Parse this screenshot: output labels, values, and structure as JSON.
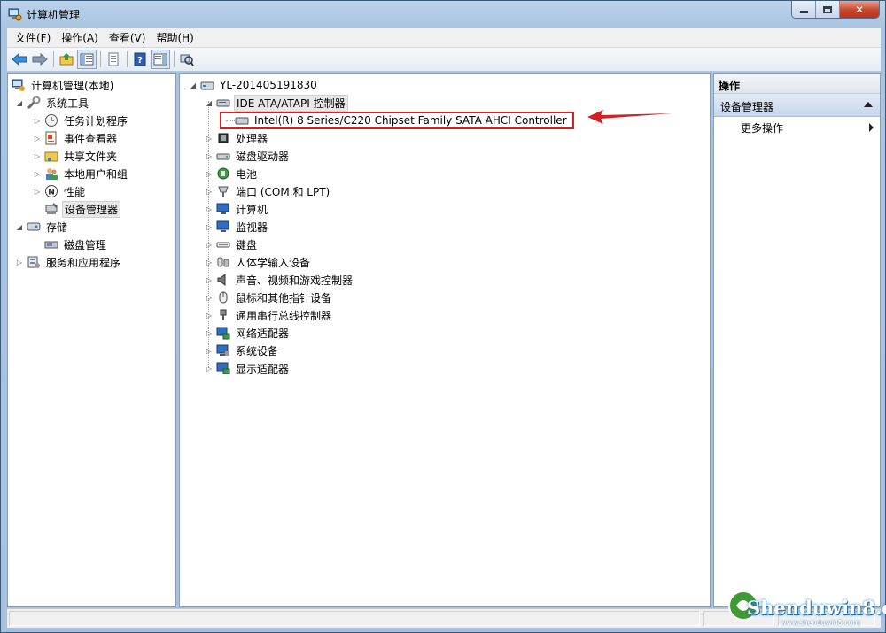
{
  "window": {
    "title": "计算机管理"
  },
  "menu": [
    "文件(F)",
    "操作(A)",
    "查看(V)",
    "帮助(H)"
  ],
  "toolbar": {
    "buttons": [
      "back-icon",
      "forward-icon",
      "up-folder-icon",
      "show-hide-tree-icon",
      "properties-icon",
      "help-icon",
      "show-action-pane-icon",
      "scan-hardware-icon"
    ]
  },
  "left_tree": {
    "root": "计算机管理(本地)",
    "system_tools": "系统工具",
    "task_scheduler": "任务计划程序",
    "event_viewer": "事件查看器",
    "shared_folders": "共享文件夹",
    "local_users": "本地用户和组",
    "performance": "性能",
    "device_manager": "设备管理器",
    "storage": "存储",
    "disk_management": "磁盘管理",
    "services_apps": "服务和应用程序"
  },
  "device_tree": {
    "computer_name": "YL-201405191830",
    "ide_controller": "IDE ATA/ATAPI 控制器",
    "ide_child": "Intel(R) 8 Series/C220 Chipset Family SATA AHCI Controller",
    "categories": [
      "处理器",
      "磁盘驱动器",
      "电池",
      "端口 (COM 和 LPT)",
      "计算机",
      "监视器",
      "键盘",
      "人体学输入设备",
      "声音、视频和游戏控制器",
      "鼠标和其他指针设备",
      "通用串行总线控制器",
      "网络适配器",
      "系统设备",
      "显示适配器"
    ]
  },
  "actions_pane": {
    "header": "操作",
    "group": "设备管理器",
    "more_actions": "更多操作"
  },
  "annotation": {
    "color": "#d61f1f"
  },
  "watermark": {
    "text": "Shenduwin8.com",
    "sub": "www.shenduwin8.com"
  }
}
